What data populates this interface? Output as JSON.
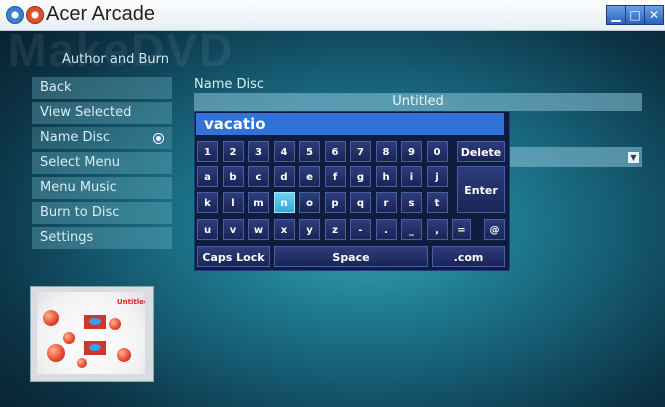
{
  "window": {
    "title": "Acer Arcade",
    "watermark": "MakeDVD"
  },
  "section_title": "Author and Burn",
  "menu": {
    "items": [
      {
        "label": "Back"
      },
      {
        "label": "View Selected"
      },
      {
        "label": "Name Disc"
      },
      {
        "label": "Select Menu"
      },
      {
        "label": "Menu Music"
      },
      {
        "label": "Burn to Disc"
      },
      {
        "label": "Settings"
      }
    ],
    "selected": "Name Disc"
  },
  "preview": {
    "label": "Untitled"
  },
  "name_disc": {
    "label": "Name Disc",
    "value": "Untitled"
  },
  "keyboard": {
    "input_value": "vacatio",
    "highlighted": "n",
    "rows": [
      [
        "1",
        "2",
        "3",
        "4",
        "5",
        "6",
        "7",
        "8",
        "9",
        "0",
        "Delete"
      ],
      [
        "a",
        "b",
        "c",
        "d",
        "e",
        "f",
        "g",
        "h",
        "i",
        "j",
        "Enter"
      ],
      [
        "k",
        "l",
        "m",
        "n",
        "o",
        "p",
        "q",
        "r",
        "s",
        "t"
      ],
      [
        "u",
        "v",
        "w",
        "x",
        "y",
        "z",
        "-",
        ".",
        "_",
        ",",
        "=",
        "@"
      ],
      [
        "Caps Lock",
        "Space",
        ".com"
      ]
    ]
  },
  "colors": {
    "keyboard_bg": "#0f1b3f",
    "input_bg": "#2f72d8",
    "key_highlight": "#5cc8ea"
  },
  "icons": [
    "app-icon",
    "close-app-icon",
    "minimize-icon",
    "maximize-icon",
    "close-icon",
    "radio-selected-icon",
    "chevron-down-icon"
  ]
}
